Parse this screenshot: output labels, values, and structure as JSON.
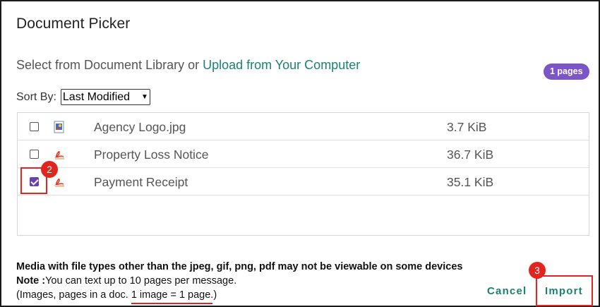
{
  "dialog": {
    "title": "Document Picker",
    "select_prefix": "Select from Document Library or ",
    "upload_link": "Upload from Your Computer",
    "pages_badge": "1 pages"
  },
  "sort": {
    "label": "Sort By:",
    "selected": "Last Modified"
  },
  "files": [
    {
      "name": "Agency Logo.jpg",
      "size": "3.7 KiB",
      "icon": "image-file-icon",
      "checked": false
    },
    {
      "name": "Property Loss Notice",
      "size": "36.7 KiB",
      "icon": "pdf-file-icon",
      "checked": false
    },
    {
      "name": "Payment Receipt",
      "size": "35.1 KiB",
      "icon": "pdf-file-icon",
      "checked": true
    }
  ],
  "footer": {
    "warning": "Media with file types other than the jpeg, gif, png, pdf may not be viewable on some devices",
    "note_label": "Note :",
    "note_text": "You can text up to 10 pages per message.",
    "images_prefix": "(Images, pages in a doc. ",
    "images_rule": "1 image = 1 page",
    "images_suffix": ".)"
  },
  "buttons": {
    "cancel": "Cancel",
    "import": "Import"
  },
  "annotations": {
    "marker_checkbox": "2",
    "marker_import": "3"
  },
  "colors": {
    "accent_teal": "#1b8173",
    "badge_purple": "#7c55c8",
    "checkbox_purple": "#6a3fb0",
    "annotation_red": "#e0261f"
  }
}
